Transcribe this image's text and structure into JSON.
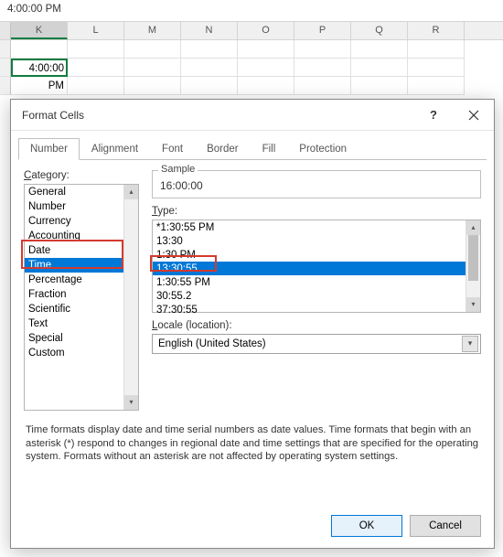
{
  "formula_value": "4:00:00 PM",
  "columns": [
    "K",
    "L",
    "M",
    "N",
    "O",
    "P",
    "Q",
    "R"
  ],
  "cell_value": "4:00:00 PM",
  "dialog": {
    "title": "Format Cells",
    "tabs": [
      "Number",
      "Alignment",
      "Font",
      "Border",
      "Fill",
      "Protection"
    ],
    "active_tab": "Number",
    "category_label": "Category:",
    "categories": [
      "General",
      "Number",
      "Currency",
      "Accounting",
      "Date",
      "Time",
      "Percentage",
      "Fraction",
      "Scientific",
      "Text",
      "Special",
      "Custom"
    ],
    "selected_category": "Time",
    "sample_label": "Sample",
    "sample_value": "16:00:00",
    "type_label": "Type:",
    "types": [
      "*1:30:55 PM",
      "13:30",
      "1:30 PM",
      "13:30:55",
      "1:30:55 PM",
      "30:55.2",
      "37:30:55"
    ],
    "selected_type": "13:30:55",
    "locale_label": "Locale (location):",
    "locale_value": "English (United States)",
    "description": "Time formats display date and time serial numbers as date values.  Time formats that begin with an asterisk (*) respond to changes in regional date and time settings that are specified for the operating system. Formats without an asterisk are not affected by operating system settings.",
    "ok": "OK",
    "cancel": "Cancel"
  }
}
